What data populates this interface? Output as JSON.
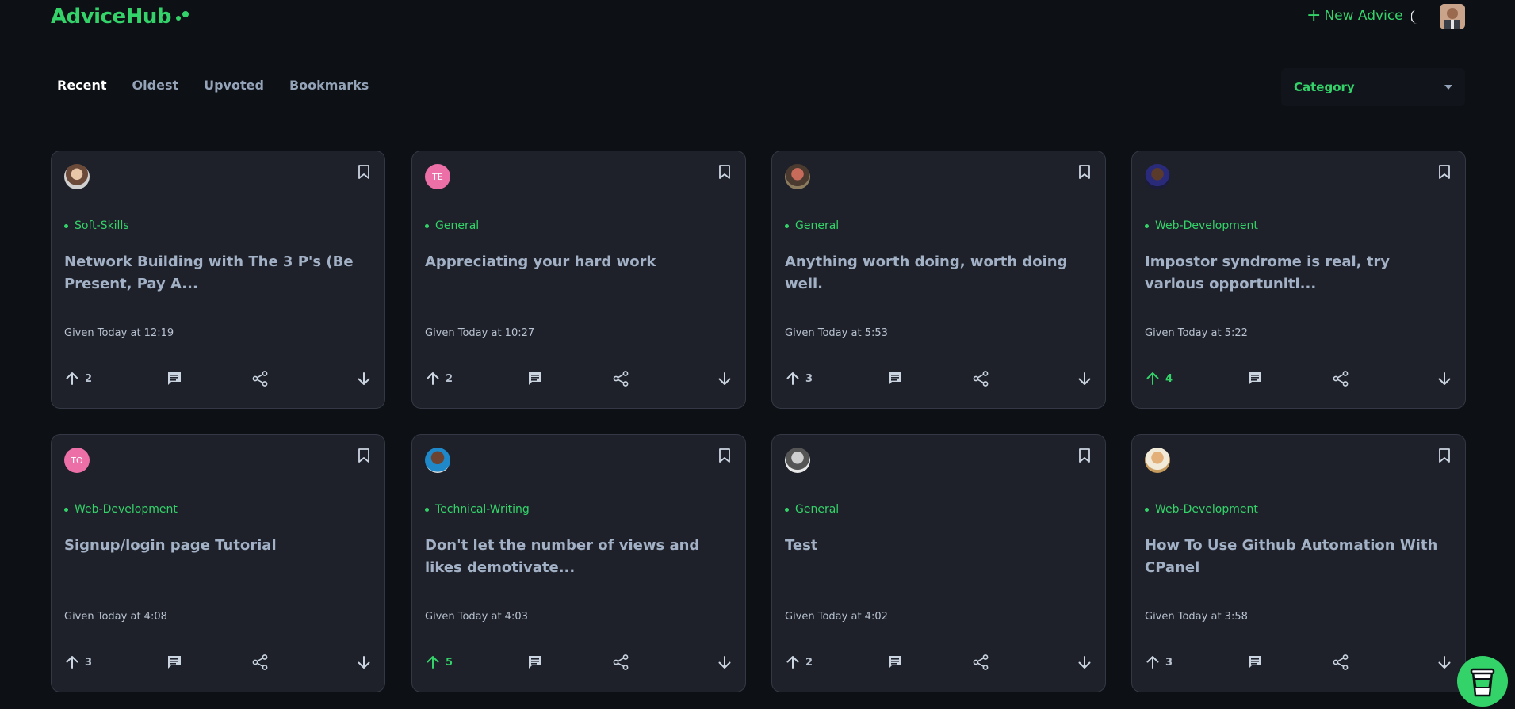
{
  "header": {
    "logo": "AdviceHub",
    "new_advice": "New Advice"
  },
  "tabs": [
    {
      "label": "Recent",
      "active": true
    },
    {
      "label": "Oldest",
      "active": false
    },
    {
      "label": "Upvoted",
      "active": false
    },
    {
      "label": "Bookmarks",
      "active": false
    }
  ],
  "category_select": {
    "selected": "Category"
  },
  "colors": {
    "accent": "#34d36a",
    "card_bg": "#1e2129",
    "page_bg": "#0d1015"
  },
  "cards": [
    {
      "avatar_initials": "",
      "avatar_kind": "photo",
      "category": "Soft-Skills",
      "title": "Network Building with The 3 P's (Be Present, Pay A...",
      "given": "Given Today at 12:19",
      "upvotes": "2",
      "upvoted": false
    },
    {
      "avatar_initials": "TE",
      "avatar_kind": "initials",
      "category": "General",
      "title": "Appreciating your hard work",
      "given": "Given Today at 10:27",
      "upvotes": "2",
      "upvoted": false
    },
    {
      "avatar_initials": "",
      "avatar_kind": "photo",
      "category": "General",
      "title": "Anything worth doing, worth doing well.",
      "given": "Given Today at 5:53",
      "upvotes": "3",
      "upvoted": false
    },
    {
      "avatar_initials": "",
      "avatar_kind": "photo",
      "category": "Web-Development",
      "title": "Impostor syndrome is real, try various opportuniti...",
      "given": "Given Today at 5:22",
      "upvotes": "4",
      "upvoted": true
    },
    {
      "avatar_initials": "TO",
      "avatar_kind": "initials",
      "category": "Web-Development",
      "title": "Signup/login page Tutorial",
      "given": "Given Today at 4:08",
      "upvotes": "3",
      "upvoted": false
    },
    {
      "avatar_initials": "",
      "avatar_kind": "photo",
      "category": "Technical-Writing",
      "title": "Don't let the number of views and likes demotivate...",
      "given": "Given Today at 4:03",
      "upvotes": "5",
      "upvoted": true
    },
    {
      "avatar_initials": "",
      "avatar_kind": "photo",
      "category": "General",
      "title": "Test",
      "given": "Given Today at 4:02",
      "upvotes": "2",
      "upvoted": false
    },
    {
      "avatar_initials": "",
      "avatar_kind": "photo",
      "category": "Web-Development",
      "title": "How To Use Github Automation With CPanel",
      "given": "Given Today at 3:58",
      "upvotes": "3",
      "upvoted": false
    }
  ]
}
